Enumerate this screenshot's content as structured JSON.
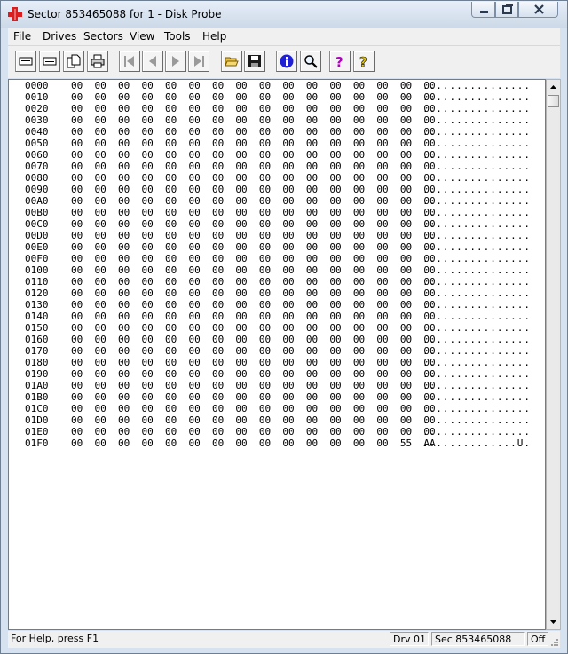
{
  "window": {
    "title": "Sector 853465088 for 1 - Disk Probe"
  },
  "menu": [
    "File",
    "Drives",
    "Sectors",
    "View",
    "Tools",
    "Help"
  ],
  "toolbar": [
    {
      "name": "drive-button-1-icon"
    },
    {
      "name": "drive-button-2-icon"
    },
    {
      "name": "copy-icon"
    },
    {
      "name": "print-icon"
    },
    {
      "name": "first-sector-icon"
    },
    {
      "name": "previous-sector-icon"
    },
    {
      "name": "next-sector-icon"
    },
    {
      "name": "last-sector-icon"
    },
    {
      "name": "open-folder-icon"
    },
    {
      "name": "save-icon"
    },
    {
      "name": "info-icon"
    },
    {
      "name": "search-icon"
    },
    {
      "name": "help-icon"
    },
    {
      "name": "context-help-icon"
    }
  ],
  "hex_rows": [
    {
      "offset": "0000",
      "bytes": "00 00 00 00 00 00 00 00 00 00 00 00 00 00 00 00",
      "ascii": "................"
    },
    {
      "offset": "0010",
      "bytes": "00 00 00 00 00 00 00 00 00 00 00 00 00 00 00 00",
      "ascii": "................"
    },
    {
      "offset": "0020",
      "bytes": "00 00 00 00 00 00 00 00 00 00 00 00 00 00 00 00",
      "ascii": "................"
    },
    {
      "offset": "0030",
      "bytes": "00 00 00 00 00 00 00 00 00 00 00 00 00 00 00 00",
      "ascii": "................"
    },
    {
      "offset": "0040",
      "bytes": "00 00 00 00 00 00 00 00 00 00 00 00 00 00 00 00",
      "ascii": "................"
    },
    {
      "offset": "0050",
      "bytes": "00 00 00 00 00 00 00 00 00 00 00 00 00 00 00 00",
      "ascii": "................"
    },
    {
      "offset": "0060",
      "bytes": "00 00 00 00 00 00 00 00 00 00 00 00 00 00 00 00",
      "ascii": "................"
    },
    {
      "offset": "0070",
      "bytes": "00 00 00 00 00 00 00 00 00 00 00 00 00 00 00 00",
      "ascii": "................"
    },
    {
      "offset": "0080",
      "bytes": "00 00 00 00 00 00 00 00 00 00 00 00 00 00 00 00",
      "ascii": "................"
    },
    {
      "offset": "0090",
      "bytes": "00 00 00 00 00 00 00 00 00 00 00 00 00 00 00 00",
      "ascii": "................"
    },
    {
      "offset": "00A0",
      "bytes": "00 00 00 00 00 00 00 00 00 00 00 00 00 00 00 00",
      "ascii": "................"
    },
    {
      "offset": "00B0",
      "bytes": "00 00 00 00 00 00 00 00 00 00 00 00 00 00 00 00",
      "ascii": "................"
    },
    {
      "offset": "00C0",
      "bytes": "00 00 00 00 00 00 00 00 00 00 00 00 00 00 00 00",
      "ascii": "................"
    },
    {
      "offset": "00D0",
      "bytes": "00 00 00 00 00 00 00 00 00 00 00 00 00 00 00 00",
      "ascii": "................"
    },
    {
      "offset": "00E0",
      "bytes": "00 00 00 00 00 00 00 00 00 00 00 00 00 00 00 00",
      "ascii": "................"
    },
    {
      "offset": "00F0",
      "bytes": "00 00 00 00 00 00 00 00 00 00 00 00 00 00 00 00",
      "ascii": "................"
    },
    {
      "offset": "0100",
      "bytes": "00 00 00 00 00 00 00 00 00 00 00 00 00 00 00 00",
      "ascii": "................"
    },
    {
      "offset": "0110",
      "bytes": "00 00 00 00 00 00 00 00 00 00 00 00 00 00 00 00",
      "ascii": "................"
    },
    {
      "offset": "0120",
      "bytes": "00 00 00 00 00 00 00 00 00 00 00 00 00 00 00 00",
      "ascii": "................"
    },
    {
      "offset": "0130",
      "bytes": "00 00 00 00 00 00 00 00 00 00 00 00 00 00 00 00",
      "ascii": "................"
    },
    {
      "offset": "0140",
      "bytes": "00 00 00 00 00 00 00 00 00 00 00 00 00 00 00 00",
      "ascii": "................"
    },
    {
      "offset": "0150",
      "bytes": "00 00 00 00 00 00 00 00 00 00 00 00 00 00 00 00",
      "ascii": "................"
    },
    {
      "offset": "0160",
      "bytes": "00 00 00 00 00 00 00 00 00 00 00 00 00 00 00 00",
      "ascii": "................"
    },
    {
      "offset": "0170",
      "bytes": "00 00 00 00 00 00 00 00 00 00 00 00 00 00 00 00",
      "ascii": "................"
    },
    {
      "offset": "0180",
      "bytes": "00 00 00 00 00 00 00 00 00 00 00 00 00 00 00 00",
      "ascii": "................"
    },
    {
      "offset": "0190",
      "bytes": "00 00 00 00 00 00 00 00 00 00 00 00 00 00 00 00",
      "ascii": "................"
    },
    {
      "offset": "01A0",
      "bytes": "00 00 00 00 00 00 00 00 00 00 00 00 00 00 00 00",
      "ascii": "................"
    },
    {
      "offset": "01B0",
      "bytes": "00 00 00 00 00 00 00 00 00 00 00 00 00 00 00 00",
      "ascii": "................"
    },
    {
      "offset": "01C0",
      "bytes": "00 00 00 00 00 00 00 00 00 00 00 00 00 00 00 00",
      "ascii": "................"
    },
    {
      "offset": "01D0",
      "bytes": "00 00 00 00 00 00 00 00 00 00 00 00 00 00 00 00",
      "ascii": "................"
    },
    {
      "offset": "01E0",
      "bytes": "00 00 00 00 00 00 00 00 00 00 00 00 00 00 00 00",
      "ascii": "................"
    },
    {
      "offset": "01F0",
      "bytes": "00 00 00 00 00 00 00 00 00 00 00 00 00 00 55 AA",
      "ascii": "..............U."
    }
  ],
  "status": {
    "help": "For Help, press F1",
    "drive": "Drv  01",
    "sector": "Sec 853465088",
    "mode": "Off"
  }
}
